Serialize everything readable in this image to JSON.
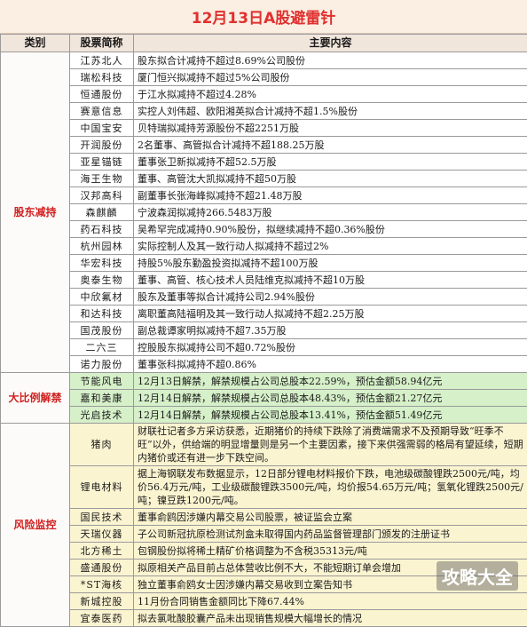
{
  "title": "12月13日A股避雷针",
  "columns": [
    "类别",
    "股票简称",
    "主要内容"
  ],
  "categories": [
    "股东减持",
    "大比例解禁",
    "风险监控"
  ],
  "rows": [
    {
      "stock": "江苏北人",
      "content": "股东拟合计减持不超过8.69%公司股份"
    },
    {
      "stock": "瑞松科技",
      "content": "厦门恒兴拟减持不超过5%公司股份"
    },
    {
      "stock": "恒通股份",
      "content": "于江水拟减持不超过4.28%"
    },
    {
      "stock": "赛意信息",
      "content": "实控人刘伟超、欧阳湘英拟合计减持不超1.5%股份"
    },
    {
      "stock": "中国宝安",
      "content": "贝特瑞拟减持芳源股份不超2251万股"
    },
    {
      "stock": "开润股份",
      "content": "2名董事、高管拟合计减持不超188.25万股"
    },
    {
      "stock": "亚星锚链",
      "content": "董事张卫新拟减持不超52.5万股"
    },
    {
      "stock": "海王生物",
      "content": "董事、高管沈大凯拟减持不超50万股"
    },
    {
      "stock": "汉邦高科",
      "content": "副董事长张海峰拟减持不超21.48万股"
    },
    {
      "stock": "森麒麟",
      "content": "宁波森润拟减持266.5483万股"
    },
    {
      "stock": "药石科技",
      "content": "吴希罕完成减持0.90%股份，拟继续减持不超0.36%股份"
    },
    {
      "stock": "杭州园林",
      "content": "实际控制人及其一致行动人拟减持不超过2%"
    },
    {
      "stock": "华宏科技",
      "content": "持股5%股东勤盈投资拟减持不超100万股"
    },
    {
      "stock": "奥泰生物",
      "content": "董事、高管、核心技术人员陆维克拟减持不超10万股"
    },
    {
      "stock": "中欣氟材",
      "content": "股东及董事等拟合计减持公司2.94%股份"
    },
    {
      "stock": "和达科技",
      "content": "离职董高陆福明及其一致行动人拟减持不超2.25万股"
    },
    {
      "stock": "国茂股份",
      "content": "副总裁谭家明拟减持不超7.35万股"
    },
    {
      "stock": "二六三",
      "content": "控股股东拟减持公司不超0.72%股份"
    },
    {
      "stock": "诺力股份",
      "content": "董事张科拟减持不超0.86%"
    },
    {
      "stock": "节能风电",
      "content": "12月13日解禁，解禁规模占公司总股本22.59%，预估金额58.94亿元"
    },
    {
      "stock": "嘉和美康",
      "content": "12月14日解禁，解禁规模占公司总股本48.43%，预估金额21.27亿元"
    },
    {
      "stock": "光启技术",
      "content": "12月14日解禁，解禁规模占公司总股本13.41%，预估金额51.49亿元"
    },
    {
      "stock": "猪肉",
      "content": "财联社记者多方采访获悉，近期猪价的持续下跌除了消费端需求不及预期导致“旺季不旺”以外，供给端的明显增量则是另一个主要因素，接下来供强需弱的格局有望延续，短期内猪价或还有进一步下跌空间。"
    },
    {
      "stock": "锂电材料",
      "content": "据上海钢联发布数据显示，12日部分锂电材料报价下跌，电池级碳酸锂跌2500元/吨，均价56.4万元/吨，工业级碳酸锂跌3500元/吨，均价报54.65万元/吨；氢氧化锂跌2500元/吨；镍豆跌1200元/吨。"
    },
    {
      "stock": "国民技术",
      "content": "董事俞鸥因涉嫌内幕交易公司股票，被证监会立案"
    },
    {
      "stock": "天瑞仪器",
      "content": "子公司新冠抗原检测试剂盒未取得国内药品监督管理部门颁发的注册证书"
    },
    {
      "stock": "北方稀土",
      "content": "包钢股份拟将稀土精矿价格调整为不含税35313元/吨"
    },
    {
      "stock": "盛通股份",
      "content": "拟原相关产品目前占总体营收比例不大，不能短期订单会增加"
    },
    {
      "stock": "*ST海核",
      "content": "独立董事俞鸥女士因涉嫌内幕交易收到立案告知书"
    },
    {
      "stock": "新城控股",
      "content": "11月份合同销售金额同比下降67.44%"
    },
    {
      "stock": "宜泰医药",
      "content": "拟去氯吡酸胶囊产品未出现销售规模大幅增长的情况"
    }
  ],
  "watermark": "攻略大全",
  "colors": {
    "title": "#e03030",
    "category": "#d02020",
    "unlock_bg": "#d6f0c9",
    "risk_bg": "#fbf4d1"
  }
}
